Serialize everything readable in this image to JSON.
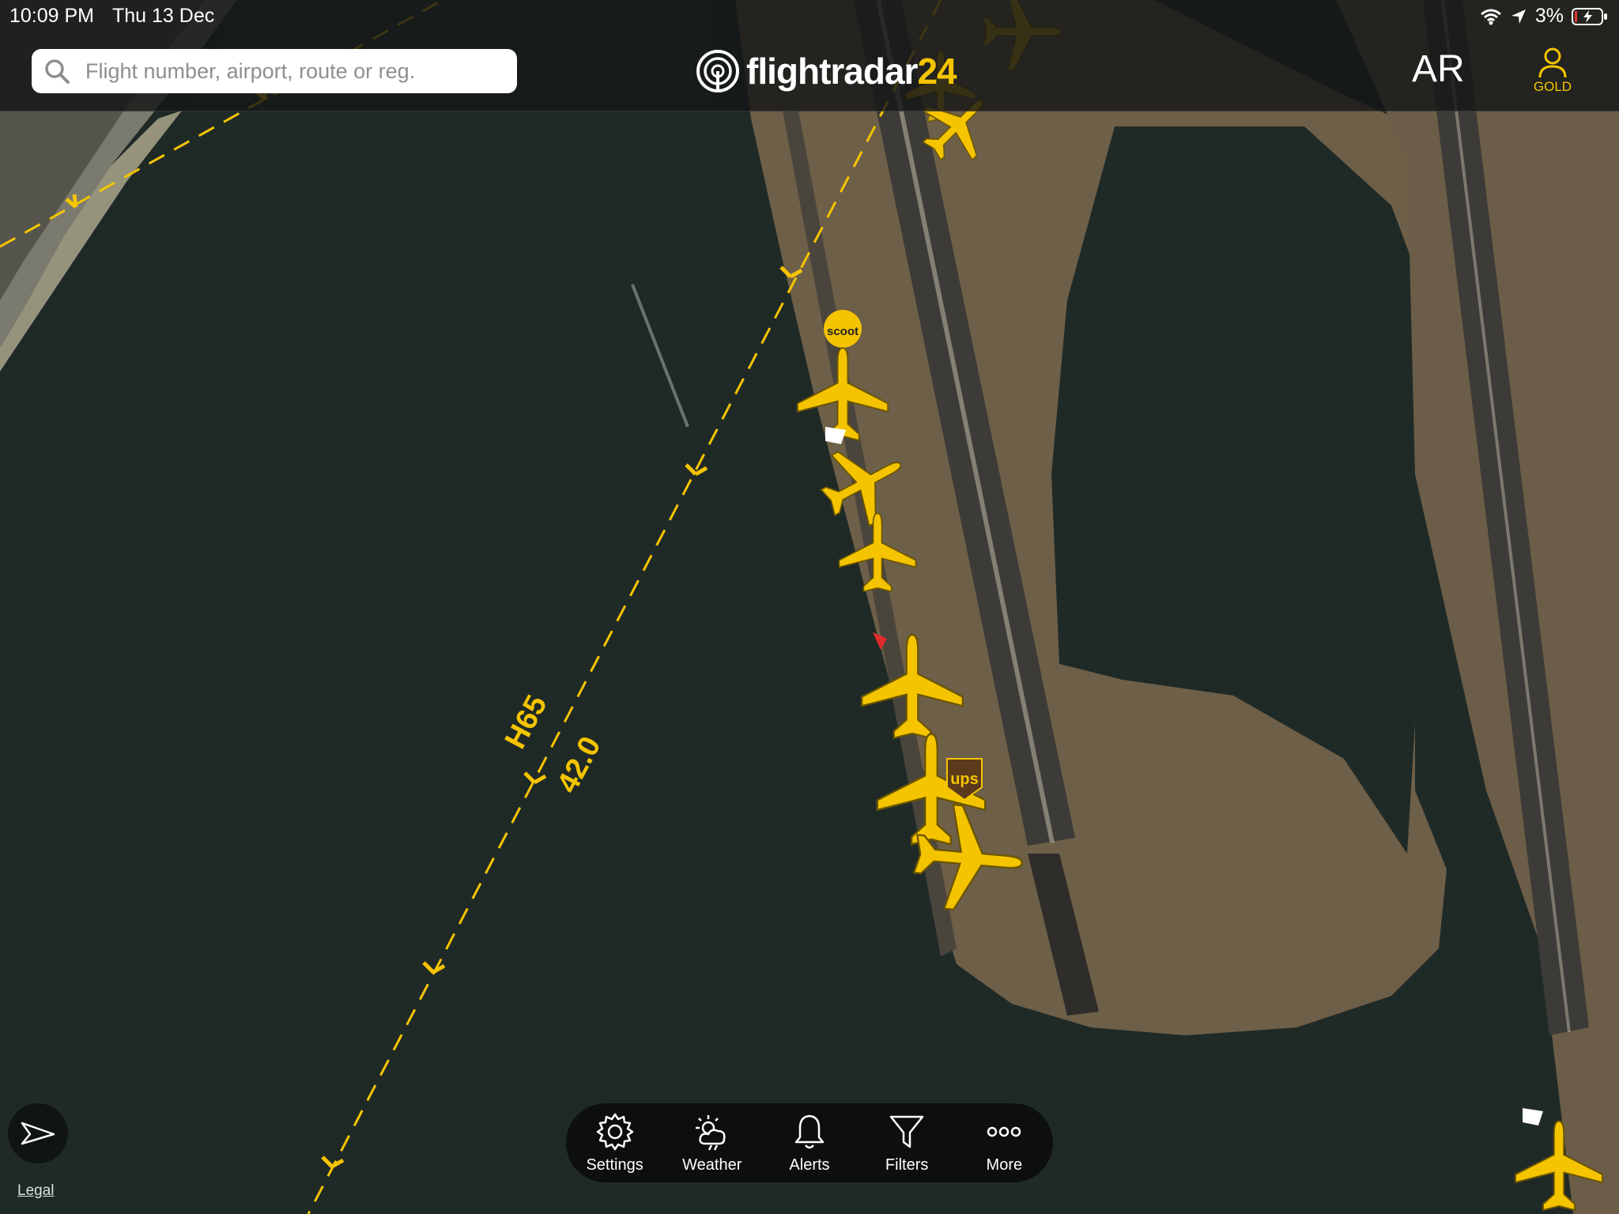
{
  "status_bar": {
    "time": "10:09 PM",
    "date": "Thu 13 Dec",
    "battery": "3%",
    "icons": [
      "wifi-icon",
      "location-arrow-icon",
      "battery-charging-icon"
    ]
  },
  "header": {
    "search_placeholder": "Flight number, airport, route or reg.",
    "logo_text": "flightradar",
    "logo_number": "24",
    "ar_label": "AR",
    "account_label": "GOLD"
  },
  "map": {
    "airway_name": "H65",
    "airway_heading": "42.0",
    "airline_badge": "scoot",
    "cargo_badge": "ups",
    "colors": {
      "accent": "#f5c400",
      "water": "#1f2a27",
      "land": "#6e5f48"
    }
  },
  "toolbar": {
    "items": [
      {
        "label": "Settings",
        "icon": "gear-icon"
      },
      {
        "label": "Weather",
        "icon": "weather-icon"
      },
      {
        "label": "Alerts",
        "icon": "bell-icon"
      },
      {
        "label": "Filters",
        "icon": "filter-icon"
      },
      {
        "label": "More",
        "icon": "more-icon"
      }
    ]
  },
  "footer": {
    "legal_label": "Legal"
  }
}
